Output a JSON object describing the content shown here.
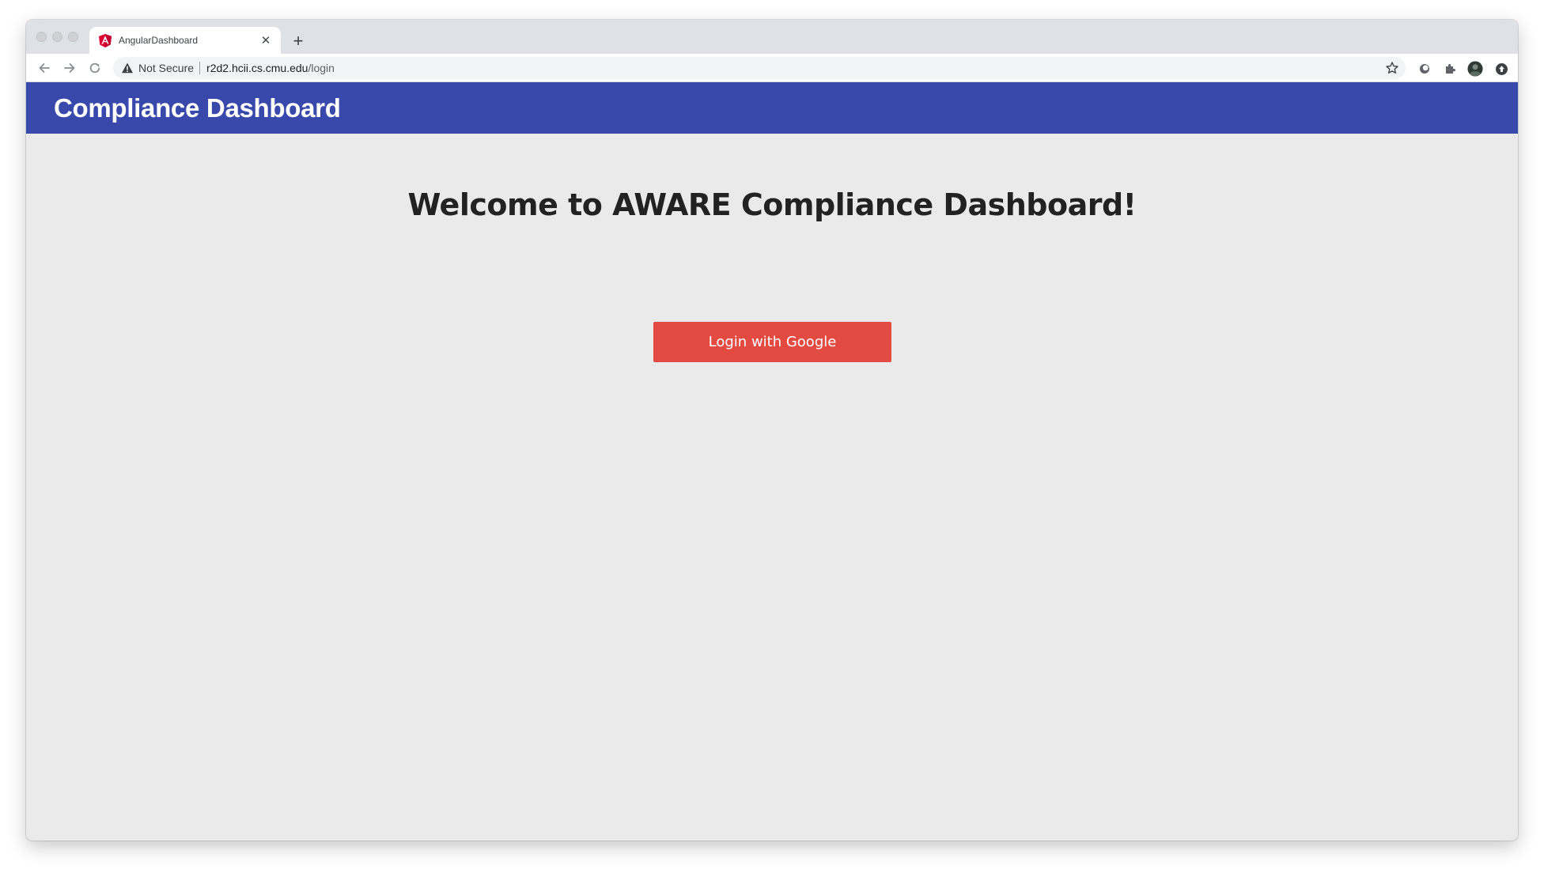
{
  "browser": {
    "tab": {
      "title": "AngularDashboard",
      "favicon_icon": "angular-logo-icon",
      "close_glyph": "✕"
    },
    "new_tab_glyph": "+",
    "address_bar": {
      "security_label": "Not Secure",
      "url_host": "r2d2.hcii.cs.cmu.edu",
      "url_path": "/login"
    }
  },
  "app": {
    "header_title": "Compliance Dashboard",
    "header_color": "#3949ab"
  },
  "main": {
    "welcome_heading": "Welcome to AWARE Compliance Dashboard!",
    "login_button_label": "Login with Google",
    "login_button_color": "#e34a42"
  }
}
